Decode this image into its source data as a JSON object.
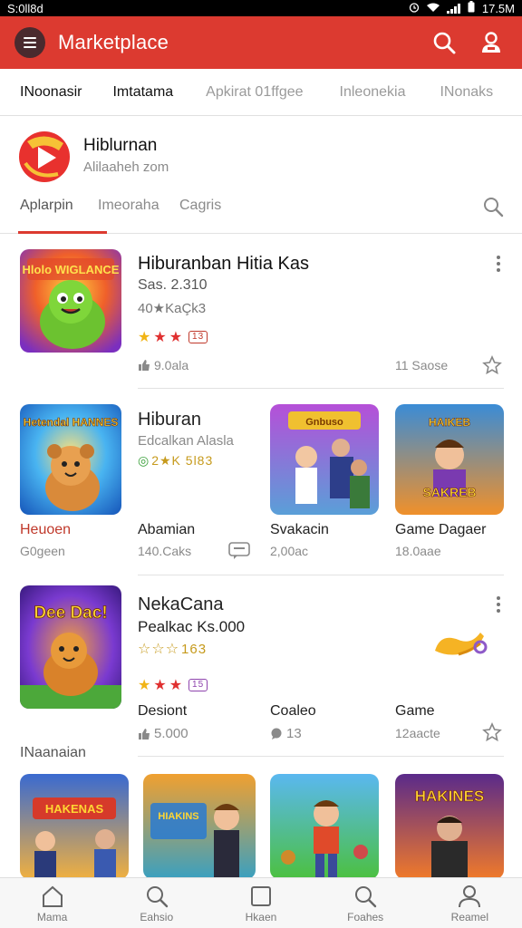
{
  "status": {
    "left": "S:0ll8d",
    "time": "17.5M"
  },
  "appbar": {
    "title": "Marketplace"
  },
  "topnav": {
    "tabs": [
      "INoonasir",
      "Imtatama",
      "Apkirat 01ffgee",
      "Inleonekia",
      "INonaks"
    ]
  },
  "developer": {
    "name": "Hiblurnan",
    "subtitle": "Alilaaheh zom",
    "tabs": [
      "Aplarpin",
      "Imeoraha",
      "Cagris"
    ]
  },
  "featured": {
    "title": "Hiburanban Hitia Kas",
    "price": "Sas. 2.310",
    "rank": "40★KaÇk3",
    "rating_badge": "13",
    "downloads": "9.0ala",
    "size": "11 Saose",
    "thumb_text": "Hlolo WIGLANCE"
  },
  "row2": {
    "left_label": "Heuoen",
    "left_sublabel": "G0geen",
    "thumb_text": "Hetendal HANNES",
    "title": "Hiburan",
    "subtitle": "Edcalkan Alasla",
    "meta_text": "2★K 5l83",
    "col1_label": "Abamian",
    "col1_sub": "140.Caks",
    "col2_label": "Svakacin",
    "col2_sub": "2,00ac",
    "col3_label": "Game Dagaer",
    "col3_sub": "18.0aae",
    "thumb2_text": "Gnbuso",
    "thumb3_text": "HAIKEB SAKREB"
  },
  "row3": {
    "thumb_text": "Dee Dac!",
    "title": "NekaCana",
    "price": "Pealkac Ks.000",
    "rating": "163",
    "rating_badge": "15",
    "col1_label": "Desiont",
    "col1_sub": "5.000",
    "col2_label": "Coaleo",
    "col2_sub": "13",
    "col3_label": "Game",
    "col3_sub": "12aacte"
  },
  "section": {
    "label": "INaanaian"
  },
  "row4": {
    "thumb1_text": "HAKENAS",
    "thumb2_text": "HIAKINS",
    "thumb4_text": "HAKINES"
  },
  "bottomnav": {
    "items": [
      "Mama",
      "Eahsio",
      "Hkaen",
      "Foahes",
      "Reamel"
    ]
  },
  "colors": {
    "accent": "#dc3a30",
    "star": "#e03030",
    "star_empty": "#f1b416"
  }
}
